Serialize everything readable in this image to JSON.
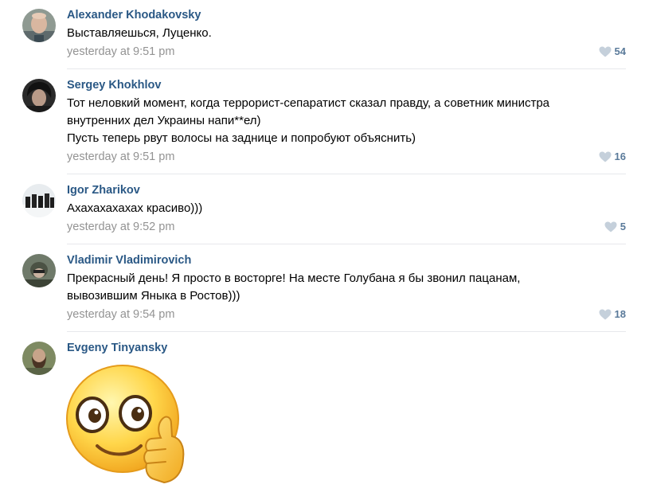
{
  "comments": [
    {
      "author": "Alexander Khodakovsky",
      "lines": [
        "Выставляешься, Луценко."
      ],
      "time": "yesterday at 9:51 pm",
      "likes": "54",
      "avatar": "avatar-bald-man"
    },
    {
      "author": "Sergey Khokhlov",
      "lines": [
        "Тот неловкий момент, когда террорист-сепаратист сказал правду, а советник министра",
        "внутренних дел Украины напи**ел)",
        "Пусть теперь рвут волосы на заднице и попробуют объяснить)"
      ],
      "time": "yesterday at 9:51 pm",
      "likes": "16",
      "avatar": "avatar-dark-hair"
    },
    {
      "author": "Igor Zharikov",
      "lines": [
        "Ахахахахахах красиво)))"
      ],
      "time": "yesterday at 9:52 pm",
      "likes": "5",
      "avatar": "avatar-group-snow"
    },
    {
      "author": "Vladimir Vladimirovich",
      "lines": [
        "Прекрасный день! Я просто в восторге! На месте Голубана я бы звонил пацанам,",
        "вывозившим Яныка в Ростов)))"
      ],
      "time": "yesterday at 9:54 pm",
      "likes": "18",
      "avatar": "avatar-helmet-soldier"
    },
    {
      "author": "Evgeny Tinyansky",
      "lines": [],
      "sticker": "thumbs-up-smiley-sticker",
      "avatar": "avatar-bearded-man"
    }
  ],
  "colors": {
    "author": "#2a5885",
    "meta": "#939393",
    "likes": "#5a7a9a",
    "heart": "#c5d0db",
    "divider": "#e7e8ec"
  }
}
